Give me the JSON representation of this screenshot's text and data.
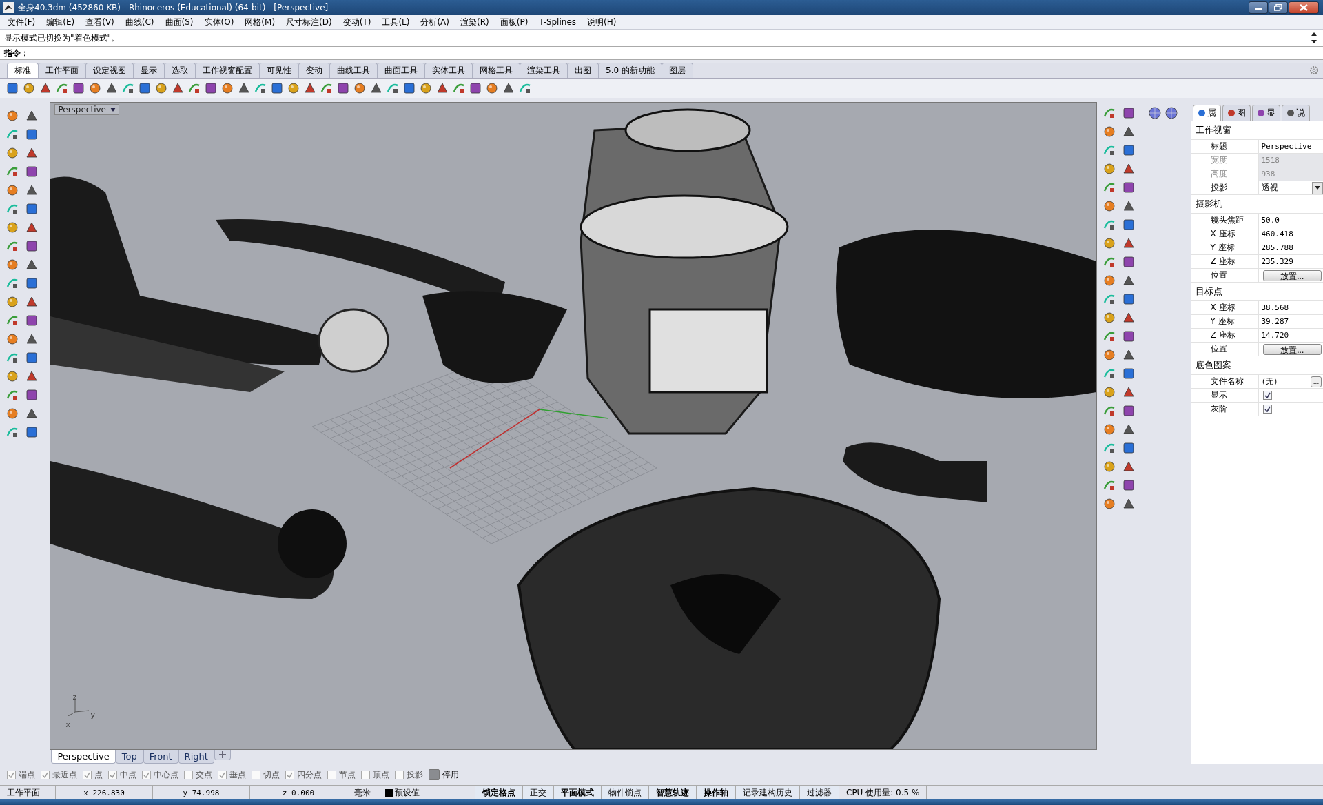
{
  "window": {
    "title": "全身40.3dm (452860 KB) - Rhinoceros (Educational) (64-bit) - [Perspective]"
  },
  "menu": [
    "文件(F)",
    "编辑(E)",
    "查看(V)",
    "曲线(C)",
    "曲面(S)",
    "实体(O)",
    "网格(M)",
    "尺寸标注(D)",
    "变动(T)",
    "工具(L)",
    "分析(A)",
    "渲染(R)",
    "面板(P)",
    "T-Splines",
    "说明(H)"
  ],
  "command_history": "显示模式已切换为\"着色模式\"。",
  "command_prompt": "指令：",
  "toolbar_tabs": [
    {
      "label": "标准",
      "selected": true
    },
    {
      "label": "工作平面",
      "selected": false
    },
    {
      "label": "设定视图",
      "selected": false
    },
    {
      "label": "显示",
      "selected": false
    },
    {
      "label": "选取",
      "selected": false
    },
    {
      "label": "工作视窗配置",
      "selected": false
    },
    {
      "label": "可见性",
      "selected": false
    },
    {
      "label": "变动",
      "selected": false
    },
    {
      "label": "曲线工具",
      "selected": false
    },
    {
      "label": "曲面工具",
      "selected": false
    },
    {
      "label": "实体工具",
      "selected": false
    },
    {
      "label": "网格工具",
      "selected": false
    },
    {
      "label": "渲染工具",
      "selected": false
    },
    {
      "label": "出图",
      "selected": false
    },
    {
      "label": "5.0 的新功能",
      "selected": false
    },
    {
      "label": "图层",
      "selected": false
    }
  ],
  "viewport": {
    "title": "Perspective",
    "axis_labels": [
      "z",
      "x",
      "y"
    ]
  },
  "viewport_tabs": [
    {
      "label": "Perspective",
      "selected": true
    },
    {
      "label": "Top",
      "selected": false
    },
    {
      "label": "Front",
      "selected": false
    },
    {
      "label": "Right",
      "selected": false
    }
  ],
  "panel_tabs": [
    {
      "label": "属",
      "selected": true
    },
    {
      "label": "图",
      "selected": false
    },
    {
      "label": "显",
      "selected": false
    },
    {
      "label": "说",
      "selected": false
    }
  ],
  "properties": [
    {
      "section": "工作视窗",
      "rows": [
        {
          "label": "标题",
          "kind": "text",
          "value": "Perspective"
        },
        {
          "label": "宽度",
          "kind": "disabled",
          "value": "1518"
        },
        {
          "label": "高度",
          "kind": "disabled",
          "value": "938"
        },
        {
          "label": "投影",
          "kind": "dropdown",
          "value": "透视"
        }
      ]
    },
    {
      "section": "摄影机",
      "rows": [
        {
          "label": "镜头焦距",
          "kind": "text",
          "value": "50.0"
        },
        {
          "label": "X 座标",
          "kind": "text",
          "value": "460.418"
        },
        {
          "label": "Y 座标",
          "kind": "text",
          "value": "285.788"
        },
        {
          "label": "Z 座标",
          "kind": "text",
          "value": "235.329"
        },
        {
          "label": "位置",
          "kind": "button",
          "value": "放置..."
        }
      ]
    },
    {
      "section": "目标点",
      "rows": [
        {
          "label": "X 座标",
          "kind": "text",
          "value": "38.568"
        },
        {
          "label": "Y 座标",
          "kind": "text",
          "value": "39.287"
        },
        {
          "label": "Z 座标",
          "kind": "text",
          "value": "14.720"
        },
        {
          "label": "位置",
          "kind": "button",
          "value": "放置..."
        }
      ]
    },
    {
      "section": "底色图案",
      "rows": [
        {
          "label": "文件名称",
          "kind": "file",
          "value": "(无)",
          "button": "..."
        },
        {
          "label": "显示",
          "kind": "checkbox",
          "checked": true
        },
        {
          "label": "灰阶",
          "kind": "checkbox",
          "checked": true
        }
      ]
    }
  ],
  "osnaps": [
    {
      "label": "端点",
      "checked": true
    },
    {
      "label": "最近点",
      "checked": true
    },
    {
      "label": "点",
      "checked": true
    },
    {
      "label": "中点",
      "checked": true
    },
    {
      "label": "中心点",
      "checked": true
    },
    {
      "label": "交点",
      "checked": false
    },
    {
      "label": "垂点",
      "checked": true
    },
    {
      "label": "切点",
      "checked": false
    },
    {
      "label": "四分点",
      "checked": true
    },
    {
      "label": "节点",
      "checked": false
    },
    {
      "label": "顶点",
      "checked": false
    },
    {
      "label": "投影",
      "checked": false
    },
    {
      "label": "停用",
      "checked": true
    }
  ],
  "status_bar": [
    {
      "kind": "text",
      "text": "工作平面"
    },
    {
      "kind": "text",
      "text": "x 226.830"
    },
    {
      "kind": "text",
      "text": "y 74.998"
    },
    {
      "kind": "text",
      "text": "z 0.000"
    },
    {
      "kind": "text",
      "text": "毫米"
    },
    {
      "kind": "layer",
      "text": "预设值",
      "color": "#000000"
    },
    {
      "kind": "toggle",
      "text": "锁定格点",
      "on": true
    },
    {
      "kind": "toggle",
      "text": "正交",
      "on": false
    },
    {
      "kind": "toggle",
      "text": "平面模式",
      "on": true
    },
    {
      "kind": "toggle",
      "text": "物件锁点",
      "on": false
    },
    {
      "kind": "toggle",
      "text": "智慧轨迹",
      "on": true
    },
    {
      "kind": "toggle",
      "text": "操作轴",
      "on": true
    },
    {
      "kind": "toggle",
      "text": "记录建构历史",
      "on": false
    },
    {
      "kind": "toggle",
      "text": "过滤器",
      "on": false
    },
    {
      "kind": "text",
      "text": "CPU 使用量: 0.5 %"
    }
  ]
}
